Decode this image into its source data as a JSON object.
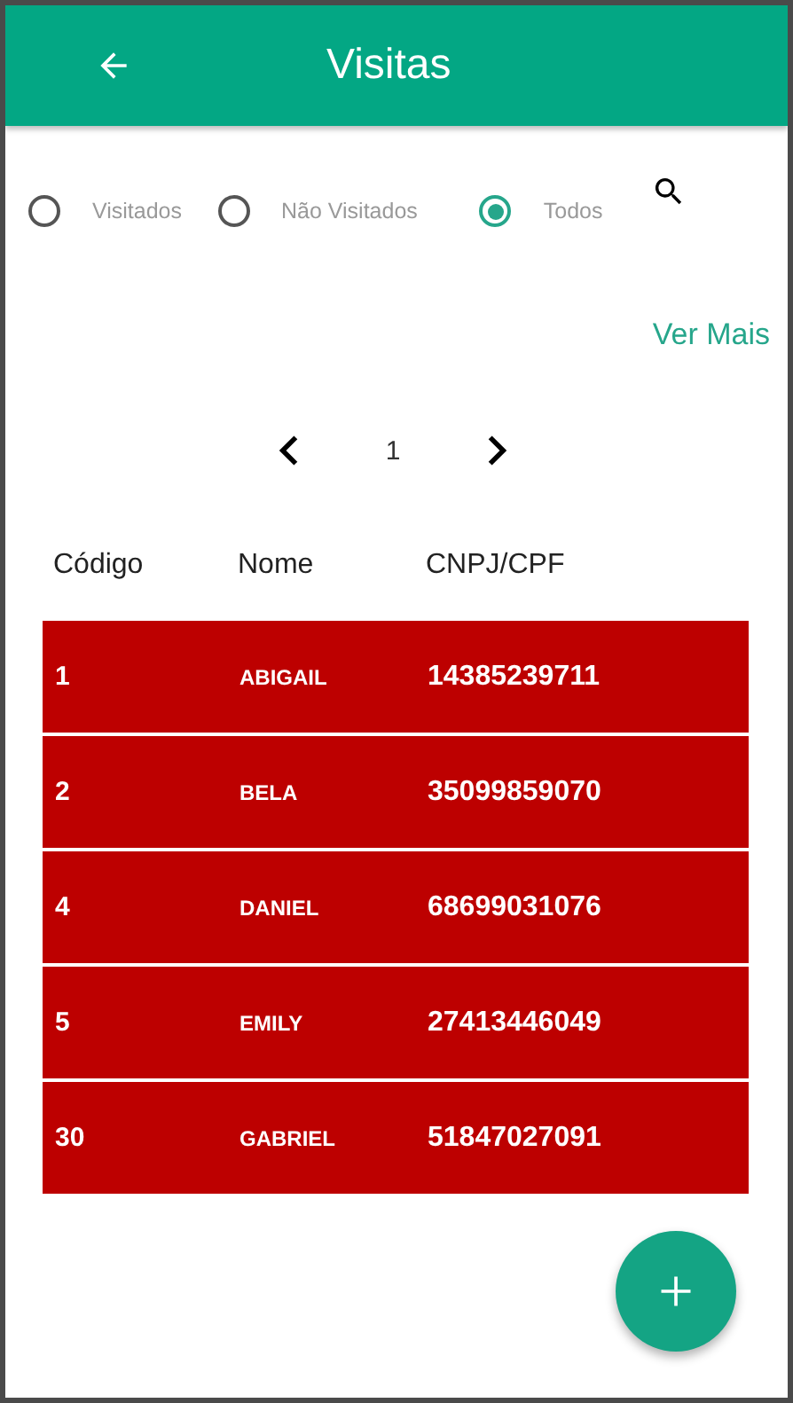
{
  "app_bar": {
    "title": "Visitas"
  },
  "filters": [
    {
      "label": "Visitados",
      "selected": false
    },
    {
      "label": "Não Visitados",
      "selected": false
    },
    {
      "label": "Todos",
      "selected": true
    }
  ],
  "more_link": "Ver Mais",
  "pager": {
    "page": "1"
  },
  "table": {
    "columns": [
      "Código",
      "Nome",
      "CNPJ/CPF"
    ],
    "rows": [
      [
        "1",
        "ABIGAIL",
        "14385239711"
      ],
      [
        "2",
        "BELA",
        "35099859070"
      ],
      [
        "4",
        "DANIEL",
        "68699031076"
      ],
      [
        "5",
        "EMILY",
        "27413446049"
      ],
      [
        "30",
        "GABRIEL",
        "51847027091"
      ]
    ]
  }
}
